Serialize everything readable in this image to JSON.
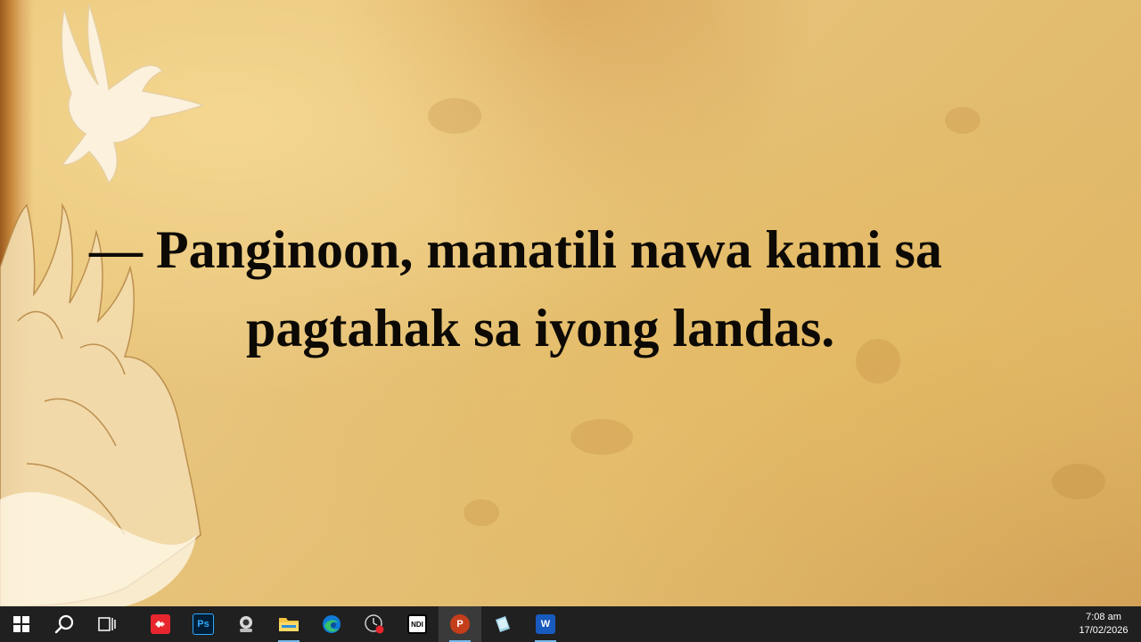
{
  "slide": {
    "verse_line1": "— Panginoon, manatili nawa kami sa",
    "verse_line2": "pagtahak sa iyong landas."
  },
  "taskbar": {
    "items": [
      {
        "name": "start-button",
        "icon": "windows-logo-icon"
      },
      {
        "name": "search-button",
        "icon": "search-icon"
      },
      {
        "name": "task-view-button",
        "icon": "task-view-icon"
      },
      {
        "name": "anydesk-app",
        "icon": "anydesk-icon",
        "color": "#e8262d"
      },
      {
        "name": "photoshop-app",
        "icon": "photoshop-icon",
        "label": "Ps",
        "color": "#001e36"
      },
      {
        "name": "webcam-app",
        "icon": "webcam-icon"
      },
      {
        "name": "file-explorer-app",
        "icon": "folder-icon",
        "color": "#f4c542"
      },
      {
        "name": "edge-app",
        "icon": "edge-icon",
        "color": "#0f7bd7"
      },
      {
        "name": "recorder-app",
        "icon": "recorder-icon"
      },
      {
        "name": "ndi-app",
        "icon": "ndi-icon",
        "label": "NDI"
      },
      {
        "name": "powerpoint-app",
        "icon": "powerpoint-icon",
        "label": "P",
        "color": "#c43e1c"
      },
      {
        "name": "notes-app",
        "icon": "notes-icon",
        "color": "#9fd3e8"
      },
      {
        "name": "word-app",
        "icon": "word-icon",
        "label": "W",
        "color": "#185abd"
      }
    ],
    "clock": {
      "time": "7:08 am",
      "date": "17/02/2026"
    }
  }
}
